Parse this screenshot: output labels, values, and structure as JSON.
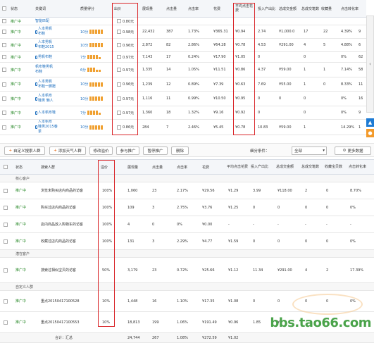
{
  "top_table": {
    "headers": [
      "状态",
      "关键词",
      "质量得分",
      "出价",
      "展现量",
      "点击量",
      "点击率",
      "花费",
      "平均点击花费",
      "投入产出比",
      "总成交金额",
      "总成交笔数",
      "点击转化率"
    ],
    "extra_headers": [
      "收藏量",
      "点击转化率"
    ],
    "rows": [
      {
        "status": "推广中",
        "kw": [
          "智能匹配"
        ],
        "phone": false,
        "qs": "",
        "bid": "0.80元",
        "impr": "",
        "clicks": "",
        "ctr": "",
        "cost": "",
        "cpc": "",
        "roi": "",
        "gmv": "",
        "orders": "",
        "fav": "",
        "cvr": "",
        "x": ""
      },
      {
        "status": "推广中",
        "kw": [
          "人本男帆",
          "布鞋"
        ],
        "phone": true,
        "qs": "10分",
        "bid": "0.98元",
        "impr": "22,432",
        "clicks": "387",
        "ctr": "1.73%",
        "cost": "¥365.31",
        "cpc": "¥0.94",
        "roi": "2.74",
        "gmv": "¥1,000.0",
        "orders": "17",
        "fav": "22",
        "cvr": "4.39%",
        "x": "9"
      },
      {
        "status": "推广中",
        "kw": [
          "人本男帆",
          "布鞋2015"
        ],
        "phone": true,
        "qs": "10分",
        "bid": "0.96元",
        "impr": "2,872",
        "clicks": "82",
        "ctr": "2.86%",
        "cost": "¥64.28",
        "cpc": "¥0.78",
        "roi": "4.53",
        "gmv": "¥291.00",
        "orders": "4",
        "fav": "5",
        "cvr": "4.88%",
        "x": "6"
      },
      {
        "status": "推广中",
        "kw": [
          "男帆布鞋"
        ],
        "phone": true,
        "qs": "7分",
        "bid": "0.97元",
        "impr": "7,143",
        "clicks": "17",
        "ctr": "0.24%",
        "cost": "¥17.90",
        "cpc": "¥1.05",
        "roi": "0",
        "gmv": "",
        "orders": "0",
        "fav": "",
        "cvr": "0%",
        "x": "62"
      },
      {
        "status": "推广中",
        "kw": [
          "帆布鞋男帆",
          "布鞋"
        ],
        "phone": false,
        "qs": "6分",
        "bid": "0.97元",
        "impr": "1,335",
        "clicks": "14",
        "ctr": "1.05%",
        "cost": "¥11.51",
        "cpc": "¥0.86",
        "roi": "4.37",
        "gmv": "¥59.00",
        "orders": "1",
        "fav": "1",
        "cvr": "7.14%",
        "x": "58"
      },
      {
        "status": "推广中",
        "kw": [
          "人本男帆",
          "布鞋一脚蹬"
        ],
        "phone": true,
        "qs": "10分",
        "bid": "0.96元",
        "impr": "1,239",
        "clicks": "12",
        "ctr": "0.89%",
        "cost": "¥7.39",
        "cpc": "¥0.63",
        "roi": "7.69",
        "gmv": "¥55.00",
        "orders": "1",
        "fav": "0",
        "cvr": "8.33%",
        "x": "11"
      },
      {
        "status": "推广中",
        "kw": [
          "人本帆布",
          "鞋男 懒人"
        ],
        "phone": true,
        "qs": "10分",
        "bid": "0.97元",
        "impr": "1,116",
        "clicks": "11",
        "ctr": "0.99%",
        "cost": "¥10.50",
        "cpc": "¥0.95",
        "roi": "0",
        "gmv": "0",
        "orders": "0",
        "fav": "",
        "cvr": "0%",
        "x": "16"
      },
      {
        "status": "推广中",
        "kw": [
          "人本帆布鞋"
        ],
        "phone": true,
        "qs": "7分",
        "bid": "0.97元",
        "impr": "1,360",
        "clicks": "18",
        "ctr": "1.32%",
        "cost": "¥9.16",
        "cpc": "¥0.92",
        "roi": "0",
        "gmv": "",
        "orders": "0",
        "fav": "",
        "cvr": "0%",
        "x": "9"
      },
      {
        "status": "推广中",
        "kw": [
          "人本帆布",
          "鞋男2015春",
          "季"
        ],
        "phone": true,
        "qs": "10分",
        "bid": "0.86元",
        "impr": "284",
        "clicks": "7",
        "ctr": "2.46%",
        "cost": "¥5.45",
        "cpc": "¥0.78",
        "roi": "10.83",
        "gmv": "¥59.00",
        "orders": "1",
        "fav": "",
        "cvr": "14.29%",
        "x": "1"
      }
    ]
  },
  "toolbar": {
    "add_keyword": "自定义搜索人群",
    "add_weather": "添加天气人群",
    "edit_bid": "修改溢价",
    "join": "参与推广",
    "pause": "暂停推广",
    "delete": "删除",
    "filter_label": "细分条件：",
    "filter_value": "全部",
    "more_data": "更多数据"
  },
  "bottom_table": {
    "headers": [
      "状态",
      "搜索人群",
      "溢价",
      "展现量",
      "点击量",
      "点击率",
      "花费",
      "平均点击花费",
      "投入产出比",
      "总成交金额",
      "总成交笔数",
      "收藏宝贝数",
      "点击转化率"
    ],
    "groups": [
      {
        "name": "核心客户",
        "rows": [
          {
            "status": "推广中",
            "name": "浏览未购买店内商品的访客",
            "prem": "100%",
            "impr": "1,060",
            "clicks": "23",
            "ctr": "2.17%",
            "cost": "¥29.56",
            "cpc": "¥1.29",
            "roi": "3.99",
            "gmv": "¥118.00",
            "orders": "2",
            "fav": "0",
            "cvr": "8.70%"
          },
          {
            "status": "推广中",
            "name": "购买过店内商品的访客",
            "prem": "100%",
            "impr": "109",
            "clicks": "3",
            "ctr": "2.75%",
            "cost": "¥3.76",
            "cpc": "¥1.25",
            "roi": "0",
            "gmv": "0",
            "orders": "0",
            "fav": "0",
            "cvr": "0%"
          },
          {
            "status": "推广中",
            "name": "店内商品放入购物车的访客",
            "prem": "100%",
            "impr": "4",
            "clicks": "0",
            "ctr": "0%",
            "cost": "¥0.00",
            "cpc": "-",
            "roi": "-",
            "gmv": "-",
            "orders": "-",
            "fav": "-",
            "cvr": "-"
          },
          {
            "status": "推广中",
            "name": "收藏过店内商品的访客",
            "prem": "100%",
            "impr": "131",
            "clicks": "3",
            "ctr": "2.29%",
            "cost": "¥4.77",
            "cpc": "¥1.59",
            "roi": "0",
            "gmv": "0",
            "orders": "0",
            "fav": "0",
            "cvr": "0%"
          }
        ]
      },
      {
        "name": "潜在客户",
        "rows": [
          {
            "status": "推广中",
            "name": "搜索过相似宝贝的访客",
            "prem": "50%",
            "impr": "3,179",
            "clicks": "23",
            "ctr": "0.72%",
            "cost": "¥25.66",
            "cpc": "¥1.12",
            "roi": "11.34",
            "gmv": "¥291.00",
            "orders": "4",
            "fav": "2",
            "cvr": "17.39%"
          }
        ]
      },
      {
        "name": "自定义人群",
        "rows": [
          {
            "status": "推广中",
            "name": "重点20150417100528",
            "prem": "10%",
            "impr": "1,448",
            "clicks": "16",
            "ctr": "1.10%",
            "cost": "¥17.35",
            "cpc": "¥1.08",
            "roi": "0",
            "gmv": "0",
            "orders": "0",
            "fav": "0",
            "cvr": "0%"
          },
          {
            "status": "推广中",
            "name": "重点20150417100553",
            "prem": "10%",
            "impr": "18,813",
            "clicks": "199",
            "ctr": "1.06%",
            "cost": "¥191.49",
            "cpc": "¥0.96",
            "roi": "1.85",
            "gmv": "¥",
            "orders": "",
            "fav": "",
            "cvr": ""
          }
        ]
      }
    ],
    "total": {
      "label": "合计：汇总",
      "impr": "24,744",
      "clicks": "267",
      "ctr": "1.08%",
      "cost": "¥272.59",
      "cpc": "¥1.02",
      "roi": "",
      "gmv": "",
      "orders": "",
      "fav": "",
      "cvr": ""
    }
  },
  "watermark": {
    "text": "bbs.tao66.com"
  },
  "colors": {
    "highlight": "#d9262a",
    "status": "#2a8a2a",
    "link": "#1e6fbf",
    "bars": "#f0a030"
  }
}
